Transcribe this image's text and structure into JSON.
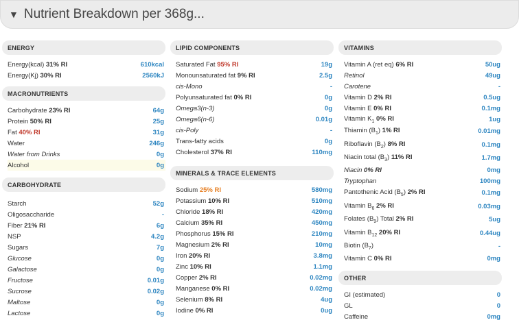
{
  "header": {
    "title": "Nutrient Breakdown per 368g..."
  },
  "energy": {
    "title": "ENERGY",
    "rows": [
      {
        "label": "Energy(kcal)",
        "ri": "31% RI",
        "value": "610kcal"
      },
      {
        "label": "Energy(Kj)",
        "ri": "30% RI",
        "value": "2560kJ"
      }
    ]
  },
  "macronutrients": {
    "title": "MACRONUTRIENTS",
    "rows": [
      {
        "label": "Carbohydrate",
        "ri": "23% RI",
        "value": "64g"
      },
      {
        "label": "Protein",
        "ri": "50% RI",
        "value": "25g"
      },
      {
        "label": "Fat",
        "ri": "40% RI",
        "value": "31g"
      },
      {
        "label": "Water",
        "ri": "",
        "value": "246g"
      },
      {
        "label": "Water from Drinks",
        "ri": "",
        "value": "0g"
      },
      {
        "label": "Alcohol",
        "ri": "",
        "value": "0g"
      }
    ]
  },
  "carbohydrate": {
    "title": "CARBOHYDRATE",
    "rows": [
      {
        "label": "Starch",
        "ri": "",
        "value": "52g"
      },
      {
        "label": "Oligosaccharide",
        "ri": "",
        "value": "-"
      },
      {
        "label": "Fiber",
        "ri": "21% RI",
        "value": "6g"
      },
      {
        "label": "NSP",
        "ri": "",
        "value": "4.2g"
      },
      {
        "label": "Sugars",
        "ri": "",
        "value": "7g"
      },
      {
        "label": "Glucose",
        "ri": "",
        "value": "0g"
      },
      {
        "label": "Galactose",
        "ri": "",
        "value": "0g"
      },
      {
        "label": "Fructose",
        "ri": "",
        "value": "0.01g"
      },
      {
        "label": "Sucrose",
        "ri": "",
        "value": "0.02g"
      },
      {
        "label": "Maltose",
        "ri": "",
        "value": "0g"
      },
      {
        "label": "Lactose",
        "ri": "",
        "value": "0g"
      }
    ]
  },
  "lipid": {
    "title": "LIPID COMPONENTS",
    "rows": [
      {
        "label": "Saturated Fat",
        "ri": "95% RI",
        "value": "19g"
      },
      {
        "label": "Monounsaturated fat",
        "ri": "9% RI",
        "value": "2.5g"
      },
      {
        "label": "cis-Mono",
        "ri": "",
        "value": "-"
      },
      {
        "label": "Polyunsaturated fat",
        "ri": "0% RI",
        "value": "0g"
      },
      {
        "label": "Omega3(n-3)",
        "ri": "",
        "value": "0g"
      },
      {
        "label": "Omega6(n-6)",
        "ri": "",
        "value": "0.01g"
      },
      {
        "label": "cis-Poly",
        "ri": "",
        "value": "-"
      },
      {
        "label": "Trans-fatty acids",
        "ri": "",
        "value": "0g"
      },
      {
        "label": "Cholesterol",
        "ri": "37% RI",
        "value": "110mg"
      }
    ]
  },
  "minerals": {
    "title": "MINERALS & TRACE ELEMENTS",
    "rows": [
      {
        "label": "Sodium",
        "ri": "25% RI",
        "value": "580mg"
      },
      {
        "label": "Potassium",
        "ri": "10% RI",
        "value": "510mg"
      },
      {
        "label": "Chloride",
        "ri": "18% RI",
        "value": "420mg"
      },
      {
        "label": "Calcium",
        "ri": "35% RI",
        "value": "450mg"
      },
      {
        "label": "Phosphorus",
        "ri": "15% RI",
        "value": "210mg"
      },
      {
        "label": "Magnesium",
        "ri": "2% RI",
        "value": "10mg"
      },
      {
        "label": "Iron",
        "ri": "20% RI",
        "value": "3.8mg"
      },
      {
        "label": "Zinc",
        "ri": "10% RI",
        "value": "1.1mg"
      },
      {
        "label": "Copper",
        "ri": "2% RI",
        "value": "0.02mg"
      },
      {
        "label": "Manganese",
        "ri": "0% RI",
        "value": "0.02mg"
      },
      {
        "label": "Selenium",
        "ri": "8% RI",
        "value": "4ug"
      },
      {
        "label": "Iodine",
        "ri": "0% RI",
        "value": "0ug"
      }
    ]
  },
  "vitamins": {
    "title": "VITAMINS",
    "rows": [
      {
        "label": "Vitamin A (ret eq)",
        "ri": "6% RI",
        "value": "50ug"
      },
      {
        "label": "Retinol",
        "ri": "",
        "value": "49ug"
      },
      {
        "label": "Carotene",
        "ri": "",
        "value": "-"
      },
      {
        "label": "Vitamin D",
        "ri": "2% RI",
        "value": "0.5ug"
      },
      {
        "label": "Vitamin E",
        "ri": "0% RI",
        "value": "0.1mg"
      },
      {
        "label": "Vitamin K",
        "sub": "1",
        "ri": "0% RI",
        "value": "1ug"
      },
      {
        "label": "Thiamin (B",
        "sub": "1",
        "suffix": ")",
        "ri": "1% RI",
        "value": "0.01mg"
      },
      {
        "label": "Riboflavin (B",
        "sub": "2",
        "suffix": ")",
        "ri": "8% RI",
        "value": "0.1mg"
      },
      {
        "label": "Niacin total (B",
        "sub": "3",
        "suffix": ")",
        "ri": "11% RI",
        "value": "1.7mg"
      },
      {
        "label": "Niacin",
        "ri": "0% RI",
        "value": "0mg"
      },
      {
        "label": "Tryptophan",
        "ri": "",
        "value": "100mg"
      },
      {
        "label": "Pantothenic Acid (B",
        "sub": "5",
        "suffix": ")",
        "ri": "2% RI",
        "value": "0.1mg"
      },
      {
        "label": "Vitamin B",
        "sub": "6",
        "ri": "2% RI",
        "value": "0.03mg"
      },
      {
        "label": "Folates (B",
        "sub": "9",
        "suffix": ") Total",
        "ri": "2% RI",
        "value": "5ug"
      },
      {
        "label": "Vitamin B",
        "sub": "12",
        "ri": "20% RI",
        "value": "0.44ug"
      },
      {
        "label": "Biotin (B",
        "sub": "7",
        "suffix": ")",
        "ri": "",
        "value": "-"
      },
      {
        "label": "Vitamin C",
        "ri": "0% RI",
        "value": "0mg"
      }
    ]
  },
  "other": {
    "title": "OTHER",
    "rows": [
      {
        "label": "GI (estimated)",
        "ri": "",
        "value": "0"
      },
      {
        "label": "GL",
        "ri": "",
        "value": "0"
      },
      {
        "label": "Caffeine",
        "ri": "",
        "value": "0mg"
      }
    ]
  }
}
